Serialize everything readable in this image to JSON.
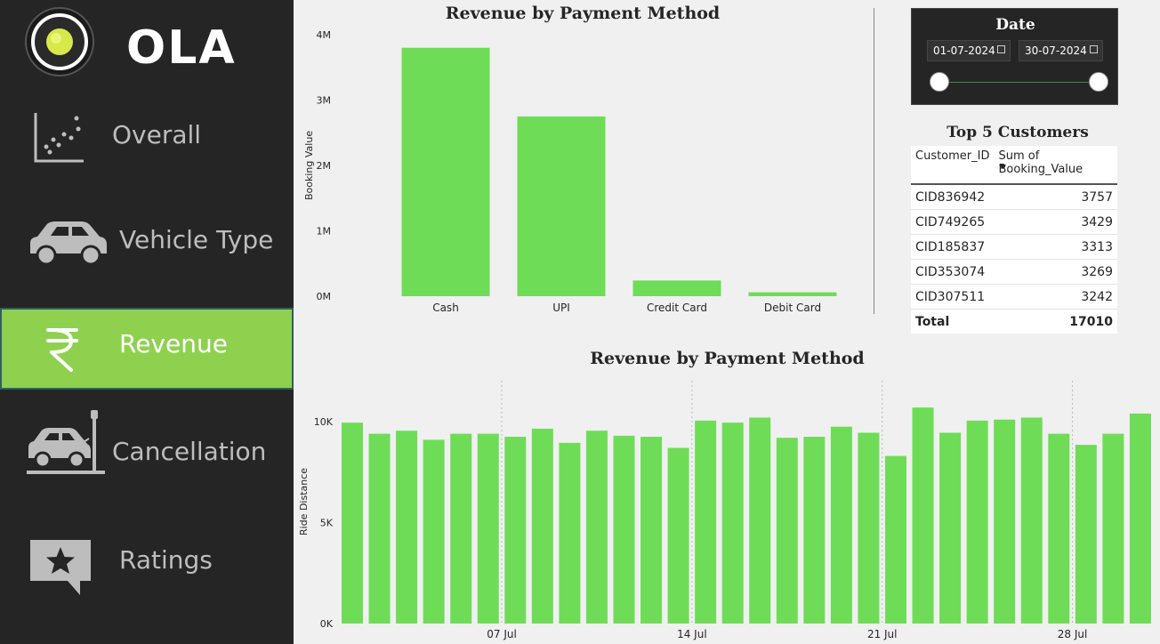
{
  "sidebar": {
    "brand": "OLA",
    "items": [
      {
        "label": "Overall"
      },
      {
        "label": "Vehicle Type"
      },
      {
        "label": "Revenue"
      },
      {
        "label": "Cancellation"
      },
      {
        "label": "Ratings"
      }
    ],
    "active_color": "#8fd14f"
  },
  "date_slicer": {
    "title": "Date",
    "start": "01-07-2024",
    "end": "30-07-2024"
  },
  "top_customers": {
    "title": "Top 5 Customers",
    "columns": [
      "Customer_ID",
      "Sum of Booking_Value"
    ],
    "rows": [
      [
        "CID836942",
        "3757"
      ],
      [
        "CID749265",
        "3429"
      ],
      [
        "CID185837",
        "3313"
      ],
      [
        "CID353074",
        "3269"
      ],
      [
        "CID307511",
        "3242"
      ]
    ],
    "total_label": "Total",
    "total_value": "17010"
  },
  "chart_data": [
    {
      "type": "bar",
      "title": "Revenue by Payment Method",
      "categories": [
        "Cash",
        "UPI",
        "Credit Card",
        "Debit Card"
      ],
      "values": [
        3800000,
        2750000,
        240000,
        60000
      ],
      "ylabel": "Booking Value",
      "xlabel": "",
      "ylim": [
        0,
        4000000
      ],
      "yticks": [
        "0M",
        "1M",
        "2M",
        "3M",
        "4M"
      ],
      "bar_color": "#6fdc57",
      "grid": false
    },
    {
      "type": "bar",
      "title": "Revenue by Payment Method",
      "x": [
        "2024-07-01",
        "2024-07-02",
        "2024-07-03",
        "2024-07-04",
        "2024-07-05",
        "2024-07-06",
        "2024-07-07",
        "2024-07-08",
        "2024-07-09",
        "2024-07-10",
        "2024-07-11",
        "2024-07-12",
        "2024-07-13",
        "2024-07-14",
        "2024-07-15",
        "2024-07-16",
        "2024-07-17",
        "2024-07-18",
        "2024-07-19",
        "2024-07-20",
        "2024-07-21",
        "2024-07-22",
        "2024-07-23",
        "2024-07-24",
        "2024-07-25",
        "2024-07-26",
        "2024-07-27",
        "2024-07-28",
        "2024-07-29",
        "2024-07-30"
      ],
      "values": [
        9950,
        9400,
        9550,
        9100,
        9400,
        9400,
        9250,
        9650,
        8950,
        9550,
        9300,
        9250,
        8700,
        10050,
        9950,
        10200,
        9200,
        9250,
        9750,
        9450,
        8300,
        10700,
        9450,
        10050,
        10100,
        10200,
        9400,
        8850,
        9400,
        10400
      ],
      "ylabel": "Ride Distance",
      "xlabel": "",
      "ylim": [
        0,
        12000
      ],
      "yticks": [
        "0K",
        "5K",
        "10K"
      ],
      "xticks": [
        "07 Jul",
        "14 Jul",
        "21 Jul",
        "28 Jul"
      ],
      "bar_color": "#6fdc57",
      "grid": false
    }
  ]
}
